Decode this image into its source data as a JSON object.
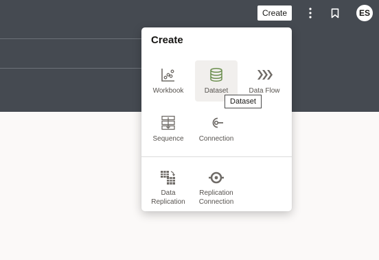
{
  "header": {
    "create_label": "Create",
    "avatar_initials": "ES"
  },
  "popup": {
    "title": "Create",
    "items": [
      {
        "label": "Workbook",
        "icon": "workbook-icon"
      },
      {
        "label": "Dataset",
        "icon": "dataset-icon"
      },
      {
        "label": "Data Flow",
        "icon": "data-flow-icon"
      },
      {
        "label": "Sequence",
        "icon": "sequence-icon"
      },
      {
        "label": "Connection",
        "icon": "connection-icon"
      }
    ],
    "replication_items": [
      {
        "label_line1": "Data",
        "label_line2": "Replication",
        "icon": "data-replication-icon"
      },
      {
        "label_line1": "Replication",
        "label_line2": "Connection",
        "icon": "replication-connection-icon"
      }
    ]
  },
  "tooltip": {
    "text": "Dataset"
  },
  "colors": {
    "header_bg": "#454a51",
    "dataset_accent": "#6b8e4e",
    "icon_gray": "#6f6b67",
    "page_bg": "#fbf9f8"
  }
}
